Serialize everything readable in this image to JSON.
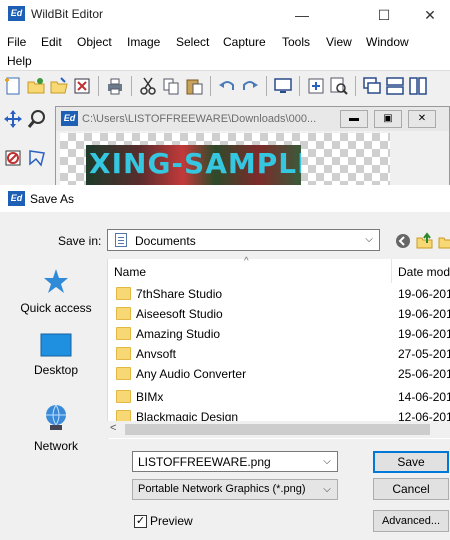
{
  "app": {
    "logo_text": "Ed",
    "title": "WildBit Editor",
    "menus": [
      "File",
      "Edit",
      "Object",
      "Image",
      "Select",
      "Capture",
      "Tools",
      "View",
      "Window",
      "Help"
    ]
  },
  "document_window": {
    "logo_text": "Ed",
    "path": "C:\\Users\\LISTOFFREEWARE\\Downloads\\000...",
    "image_text": "XING-SAMPLE"
  },
  "dialog": {
    "logo_text": "Ed",
    "title": "Save As",
    "save_in_label": "Save in:",
    "save_in_value": "Documents",
    "places": [
      {
        "label": "Quick access",
        "icon": "star-icon"
      },
      {
        "label": "Desktop",
        "icon": "desktop-icon"
      },
      {
        "label": "Network",
        "icon": "network-icon"
      }
    ],
    "columns": {
      "name": "Name",
      "date": "Date mod"
    },
    "files": [
      {
        "name": "7thShare Studio",
        "date": "19-06-201"
      },
      {
        "name": "Aiseesoft Studio",
        "date": "19-06-201"
      },
      {
        "name": "Amazing Studio",
        "date": "19-06-201"
      },
      {
        "name": "Anvsoft",
        "date": "27-05-201"
      },
      {
        "name": "Any Audio Converter",
        "date": "25-06-201"
      },
      {
        "name": "BIMx",
        "date": "14-06-201"
      },
      {
        "name": "Blackmagic Design",
        "date": "12-06-201"
      }
    ],
    "file_name_value": "LISTOFFREEWARE.png",
    "file_type_value": "Portable Network Graphics (*.png)",
    "save_label": "Save",
    "cancel_label": "Cancel",
    "advanced_label": "Advanced...",
    "preview_label": "Preview",
    "preview_checked": "✓"
  },
  "colors": {
    "accent": "#0078d7",
    "folder": "#f8d775",
    "logo": "#1d5fb5",
    "sample_text": "#35c6e0"
  }
}
